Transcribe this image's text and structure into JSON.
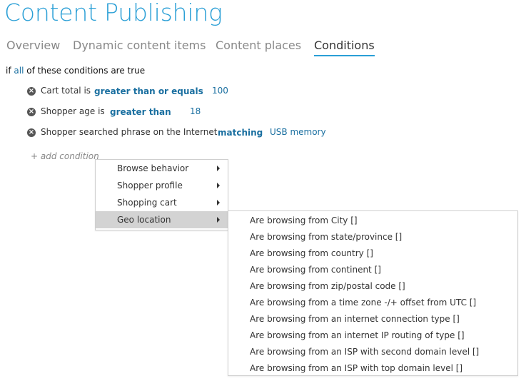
{
  "page": {
    "title": "Content Publishing"
  },
  "tabs": [
    {
      "label": "Overview",
      "active": false
    },
    {
      "label": "Dynamic content items",
      "active": false
    },
    {
      "label": "Content places",
      "active": false
    },
    {
      "label": "Conditions",
      "active": true
    }
  ],
  "rule": {
    "prefix": "if",
    "quantifier": "all",
    "suffix": "of these conditions are true"
  },
  "conditions": [
    {
      "label": "Cart total is",
      "operator": "greater than or equals",
      "value": "100"
    },
    {
      "label": "Shopper age is",
      "operator": "greater than",
      "value": "18"
    },
    {
      "label": "Shopper searched phrase on the Internet",
      "operator": "matching",
      "value": "USB memory"
    }
  ],
  "add_condition": {
    "label": "+ add condition"
  },
  "menu": {
    "items": [
      {
        "label": "Browse behavior",
        "has_submenu": true
      },
      {
        "label": "Shopper profile",
        "has_submenu": true
      },
      {
        "label": "Shopping cart",
        "has_submenu": true
      },
      {
        "label": "Geo location",
        "has_submenu": true,
        "active": true
      }
    ]
  },
  "submenu": {
    "items": [
      {
        "label": "Are browsing from City []"
      },
      {
        "label": "Are browsing from state/province []"
      },
      {
        "label": "Are browsing from country []"
      },
      {
        "label": "Are browsing from continent []"
      },
      {
        "label": "Are browsing from zip/postal code []"
      },
      {
        "label": "Are browsing from a time zone -/+ offset from UTC []"
      },
      {
        "label": "Are browsing from an internet connection type []"
      },
      {
        "label": "Are browsing from an internet IP routing of type []"
      },
      {
        "label": "Are browsing from an ISP with second domain level []"
      },
      {
        "label": "Are browsing from an ISP with top domain level []"
      }
    ]
  },
  "colors": {
    "accent": "#2a9fd6",
    "link": "#1a6fa0",
    "menu_highlight": "#d3d3d3"
  },
  "icons": {
    "remove": "close-circle-icon",
    "submenu_arrow": "caret-right-icon"
  }
}
